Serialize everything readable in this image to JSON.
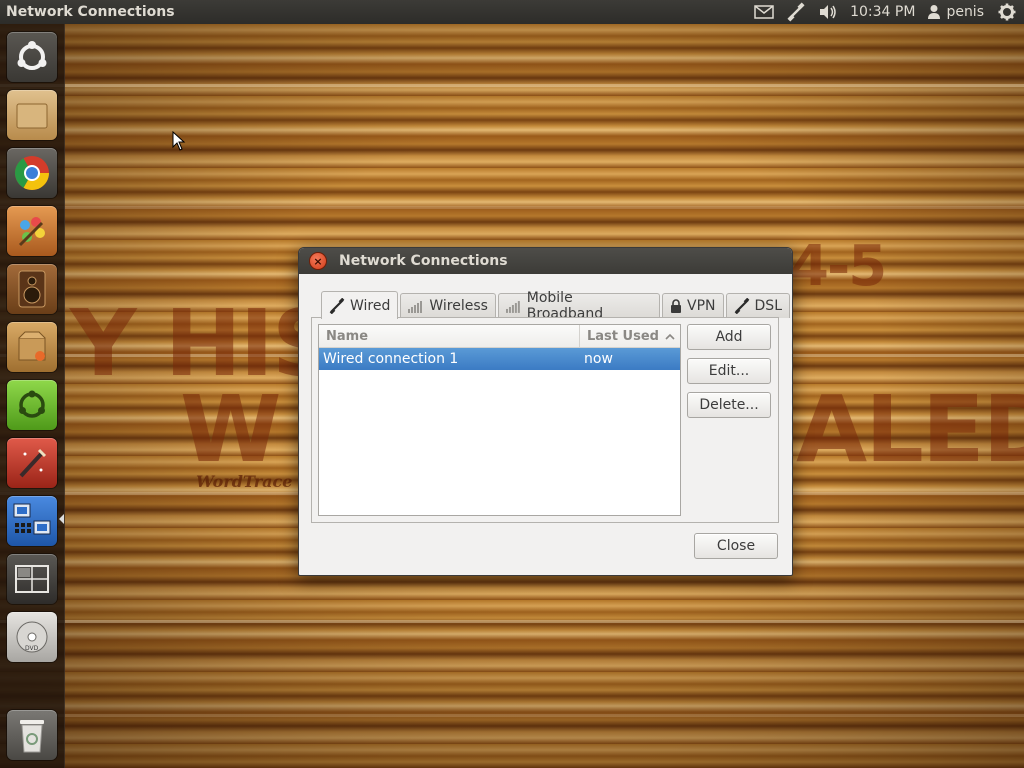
{
  "top_panel": {
    "app_title": "Network Connections",
    "clock": "10:34 PM",
    "username": "penis",
    "indicators": [
      "mail-icon",
      "network-wired-icon",
      "volume-icon",
      "user-icon",
      "gear-icon"
    ]
  },
  "wallpaper": {
    "text_line1": "Y HIS",
    "text_line2": "W",
    "text_line3": "ALED",
    "text_numbers": "4-5",
    "signature": "WordTrace"
  },
  "launcher": {
    "items": [
      {
        "name": "dash-home-icon",
        "color": "#e8e6e3"
      },
      {
        "name": "home-folder-icon",
        "color": "#c9a472"
      },
      {
        "name": "chromium-browser-icon",
        "color": "#4a4a4a"
      },
      {
        "name": "paint-icon",
        "color": "#c0692e"
      },
      {
        "name": "speaker-icon",
        "color": "#8a5a32"
      },
      {
        "name": "package-box-icon",
        "color": "#c3934f"
      },
      {
        "name": "ubuntu-software-center-icon",
        "color": "#6fbf2a"
      },
      {
        "name": "settings-wand-icon",
        "color": "#c53a2c"
      },
      {
        "name": "network-connections-icon",
        "color": "#2e6ec8"
      },
      {
        "name": "workspace-switcher-icon",
        "color": "#3a3a3a"
      },
      {
        "name": "dvd-drive-icon",
        "color": "#c9c6c0"
      },
      {
        "name": "trash-icon",
        "color": "#d3d0ca"
      }
    ]
  },
  "dialog": {
    "title": "Network Connections",
    "tabs": [
      {
        "label": "Wired",
        "icon": "wired-icon",
        "active": true
      },
      {
        "label": "Wireless",
        "icon": "signal-bars-icon",
        "active": false
      },
      {
        "label": "Mobile Broadband",
        "icon": "signal-bars-icon",
        "active": false
      },
      {
        "label": "VPN",
        "icon": "lock-icon",
        "active": false
      },
      {
        "label": "DSL",
        "icon": "wired-icon",
        "active": false
      }
    ],
    "list": {
      "columns": [
        "Name",
        "Last Used"
      ],
      "rows": [
        {
          "name": "Wired connection 1",
          "last_used": "now",
          "selected": true
        }
      ]
    },
    "buttons": {
      "add": "Add",
      "edit": "Edit...",
      "delete": "Delete...",
      "close": "Close"
    }
  }
}
